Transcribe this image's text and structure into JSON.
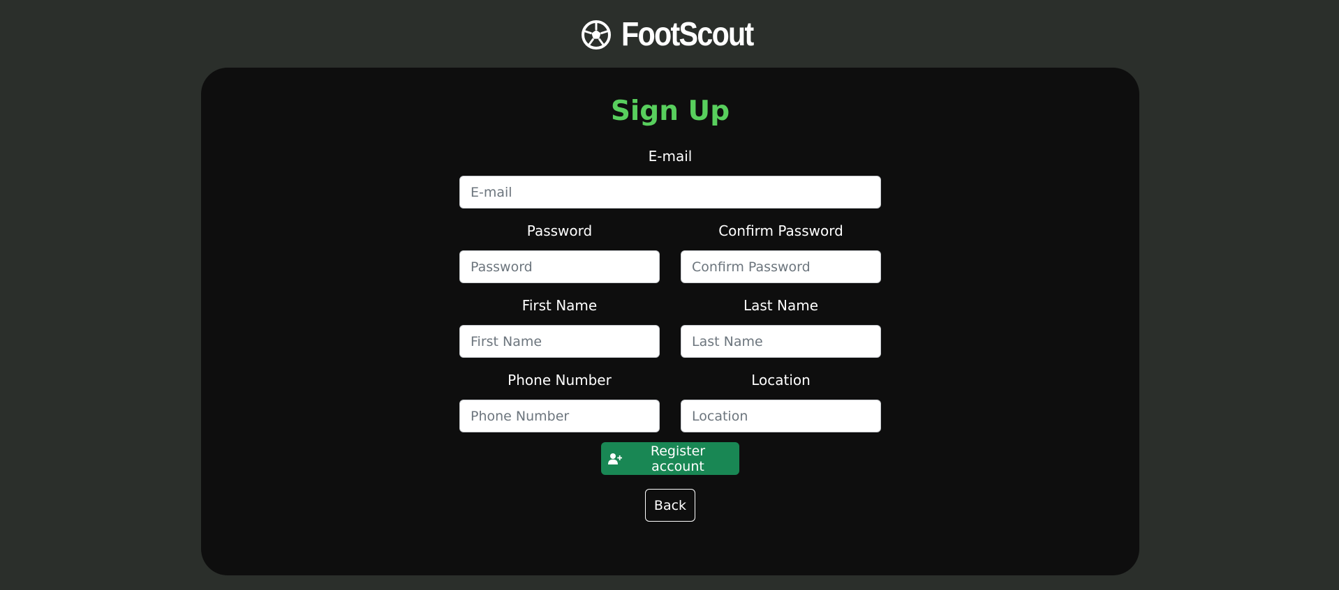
{
  "brand": {
    "logo_icon": "soccer-ball-icon",
    "name": "FootScout"
  },
  "form": {
    "title": "Sign Up",
    "fields": {
      "email": {
        "label": "E-mail",
        "placeholder": "E-mail",
        "value": ""
      },
      "password": {
        "label": "Password",
        "placeholder": "Password",
        "value": ""
      },
      "confirm_password": {
        "label": "Confirm Password",
        "placeholder": "Confirm Password",
        "value": ""
      },
      "first_name": {
        "label": "First Name",
        "placeholder": "First Name",
        "value": ""
      },
      "last_name": {
        "label": "Last Name",
        "placeholder": "Last Name",
        "value": ""
      },
      "phone": {
        "label": "Phone Number",
        "placeholder": "Phone Number",
        "value": ""
      },
      "location": {
        "label": "Location",
        "placeholder": "Location",
        "value": ""
      }
    },
    "register_button": {
      "icon": "user-plus-icon",
      "label": "Register account"
    },
    "back_button": {
      "label": "Back"
    }
  },
  "colors": {
    "page_background": "#2b2f2b",
    "card_background": "#0e0e0e",
    "title": "#58cf5d",
    "register_button": "#198754"
  }
}
